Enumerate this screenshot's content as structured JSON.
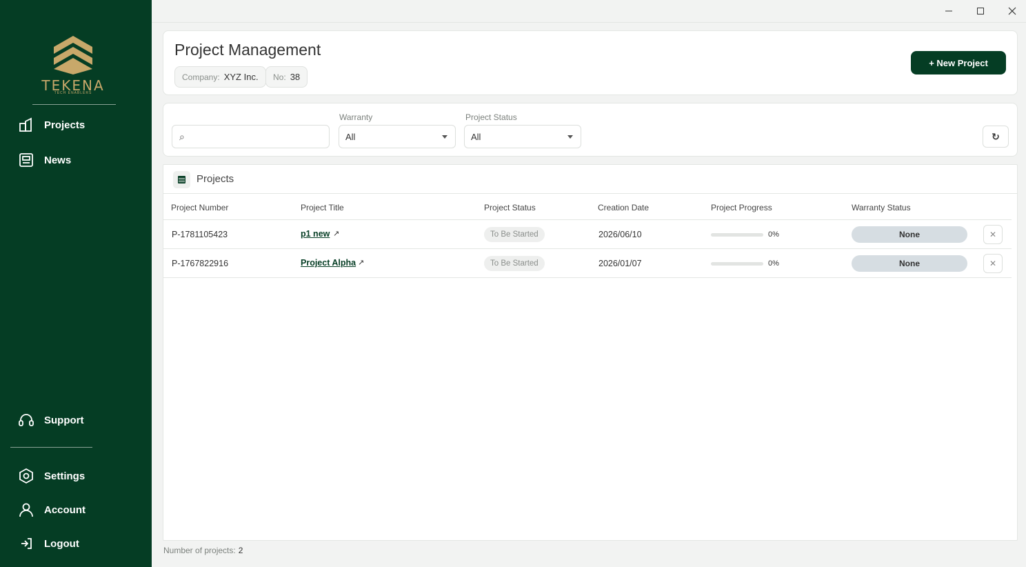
{
  "sidebar": {
    "logo_text": "TEKENA",
    "logo_subtitle": "TECH ENABLERS",
    "nav": {
      "projects": "Projects",
      "news": "News",
      "support": "Support",
      "settings": "Settings",
      "account": "Account",
      "logout": "Logout"
    }
  },
  "window_controls": {
    "minimize": "—",
    "maximize": "☐",
    "close": "✕"
  },
  "header": {
    "title": "Project Management",
    "company_label": "Company:",
    "company_value": "XYZ Inc.",
    "no_label": "No:",
    "no_value": "38",
    "new_project_button": "+ New Project"
  },
  "filters": {
    "search_value": "",
    "warranty_label": "Warranty",
    "warranty_value": "All",
    "status_label": "Project Status",
    "status_value": "All",
    "refresh_icon": "refresh-icon"
  },
  "table": {
    "title": "Projects",
    "columns": {
      "number": "Project Number",
      "title": "Project Title",
      "status": "Project Status",
      "date": "Creation Date",
      "progress": "Project Progress",
      "warranty": "Warranty Status"
    },
    "rows": [
      {
        "number": "P-1781105423",
        "title": "p1 new",
        "status": "To Be Started",
        "date": "2026/06/10",
        "progress": 0,
        "progress_text": "0%",
        "warranty": "None"
      },
      {
        "number": "P-1767822916",
        "title": "Project Alpha",
        "status": "To Be Started",
        "date": "2026/01/07",
        "progress": 0,
        "progress_text": "0%",
        "warranty": "None"
      }
    ]
  },
  "footer": {
    "label": "Number of projects:",
    "count": "2"
  },
  "colors": {
    "brand": "#053d24",
    "gold": "#c8a86a",
    "warranty_pill": "#d6dde2"
  }
}
